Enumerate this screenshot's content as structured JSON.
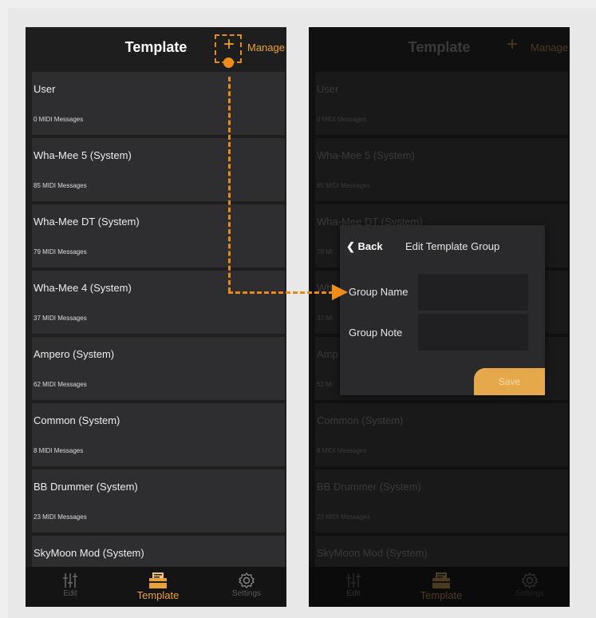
{
  "left_screen": {
    "title": "Template",
    "add_icon": "+",
    "manage_label": "Manage",
    "items": [
      {
        "name": "User",
        "count": "0 MIDI Messages"
      },
      {
        "name": "Wha-Mee 5 (System)",
        "count": "85 MIDI Messages"
      },
      {
        "name": "Wha-Mee DT (System)",
        "count": "79 MIDI Messages"
      },
      {
        "name": "Wha-Mee 4 (System)",
        "count": "37 MIDI Messages"
      },
      {
        "name": "Ampero (System)",
        "count": "62 MIDI Messages"
      },
      {
        "name": "Common (System)",
        "count": "8 MIDI Messages"
      },
      {
        "name": "BB Drummer (System)",
        "count": "23 MIDI Messages"
      },
      {
        "name": "SkyMoon Mod (System)",
        "count": ""
      }
    ],
    "tabs": [
      {
        "label": "Edit",
        "icon": "sliders-icon"
      },
      {
        "label": "Template",
        "icon": "template-folder-icon"
      },
      {
        "label": "Settings",
        "icon": "gear-icon"
      }
    ]
  },
  "right_screen": {
    "title": "Template",
    "add_icon": "+",
    "manage_label": "Manage",
    "items": [
      {
        "name": "User",
        "count": "0 MIDI Messages"
      },
      {
        "name": "Wha-Mee 5 (System)",
        "count": "85 MIDI Messages"
      },
      {
        "name": "Wha-Mee DT (System)",
        "count": "79 MI"
      },
      {
        "name": "Wh",
        "count": "37 MI"
      },
      {
        "name": "Amp",
        "count": "62 MI"
      },
      {
        "name": "Common (System)",
        "count": "8 MIDI Messages"
      },
      {
        "name": "BB Drummer (System)",
        "count": "23 MIDI Messages"
      },
      {
        "name": "SkyMoon Mod (System)",
        "count": ""
      }
    ],
    "tabs": [
      {
        "label": "Edit",
        "icon": "sliders-icon"
      },
      {
        "label": "Template",
        "icon": "template-folder-icon"
      },
      {
        "label": "Settings",
        "icon": "gear-icon"
      }
    ],
    "dialog": {
      "back_label": "Back",
      "title": "Edit Template Group",
      "group_name_label": "Group Name",
      "group_note_label": "Group Note",
      "group_name_value": "",
      "group_note_value": "",
      "save_label": "Save"
    }
  },
  "colors": {
    "accent": "#e9a23b",
    "annotation": "#e8891c",
    "background": "#1e1e1e",
    "card": "#2e2e30"
  }
}
